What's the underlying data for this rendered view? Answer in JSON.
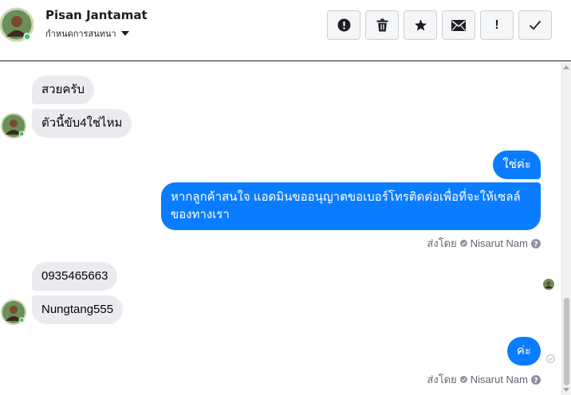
{
  "header": {
    "contact_name": "Pisan Jantamat",
    "assign_label": "กำหนดการสนทนา",
    "actions": [
      {
        "name": "spam-button",
        "icon": "exclamation-circle-icon"
      },
      {
        "name": "delete-button",
        "icon": "trash-icon"
      },
      {
        "name": "star-button",
        "icon": "star-icon"
      },
      {
        "name": "mark-unread-button",
        "icon": "envelope-icon"
      },
      {
        "name": "follow-up-button",
        "icon": "exclamation-icon",
        "glyph": "!"
      },
      {
        "name": "mark-done-button",
        "icon": "check-icon"
      }
    ]
  },
  "messages": {
    "m1": "สวยครับ",
    "m2": "ตัวนี้ขับ4ใช่ไหม",
    "m3": "ใช่ค่ะ",
    "m4_line1": "หากลูกค้าสนใจ แอดมินขออนุญาตขอเบอร์โทรติดต่อเพื่อที่จะให้เซลล์",
    "m4_line2": "ของทางเรา",
    "m5": "0935465663",
    "m6": "Nungtang555",
    "m7": "ค่ะ"
  },
  "sent_by": {
    "label": "ส่งโดย",
    "agent": "Nisarut Nam"
  },
  "colors": {
    "outgoing": "#0a7cff",
    "incoming": "#e9ebee",
    "muted": "#606770"
  }
}
